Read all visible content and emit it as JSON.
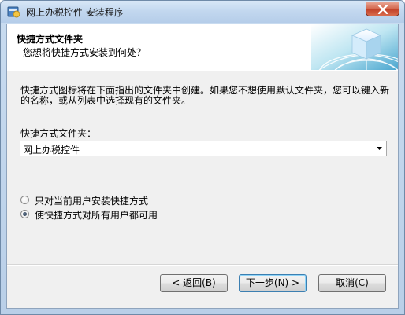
{
  "window": {
    "title": "网上办税控件 安装程序",
    "icons": {
      "app": "installer-icon",
      "close": "close-icon",
      "graphic": "globe-cube-icon",
      "dropdown": "chevron-down-icon"
    }
  },
  "header": {
    "title": "快捷方式文件夹",
    "subtitle": "您想将快捷方式安装到何处？"
  },
  "main": {
    "description": "快捷方式图标将在下面指出的文件夹中创建。如果您不想使用默认文件夹，您可以键入新的名称，或从列表中选择现有的文件夹。",
    "folder_label": "快捷方式文件夹：",
    "folder_value": "网上办税控件",
    "radio_options": [
      {
        "label": "只对当前用户安装快捷方式",
        "selected": false
      },
      {
        "label": "使快捷方式对所有用户都可用",
        "selected": true
      }
    ]
  },
  "buttons": {
    "back": "< 返回(B)",
    "next": "下一步(N) >",
    "cancel": "取消(C)"
  },
  "colors": {
    "close_button": "#c2432a",
    "default_button_border": "#3c7fb1"
  }
}
